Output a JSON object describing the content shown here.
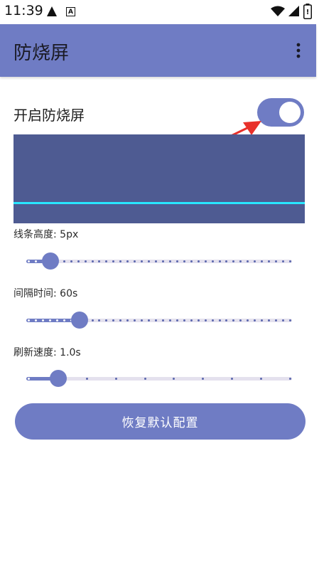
{
  "status_bar": {
    "time": "11:39",
    "icons": [
      "warning-icon",
      "a-notification-icon",
      "wifi-icon",
      "signal-icon",
      "battery-icon"
    ]
  },
  "app_bar": {
    "title": "防烧屏",
    "background_color": "#6f7cc4",
    "overflow_icon": "more-vert-icon"
  },
  "toggle": {
    "label": "开启防烧屏",
    "checked": true
  },
  "preview": {
    "background_color": "#4e5b92",
    "line_color": "#29e6ff"
  },
  "sliders": [
    {
      "label": "线条高度: 5px",
      "value_fraction": 0.09,
      "ticks": 38
    },
    {
      "label": "间隔时间: 60s",
      "value_fraction": 0.2,
      "ticks": 38
    },
    {
      "label": "刷新速度: 1.0s",
      "value_fraction": 0.12,
      "ticks": 10
    }
  ],
  "reset_button": {
    "label": "恢复默认配置"
  },
  "accent_color": "#6f7cc4",
  "annotation_arrow_color": "#e8302a"
}
